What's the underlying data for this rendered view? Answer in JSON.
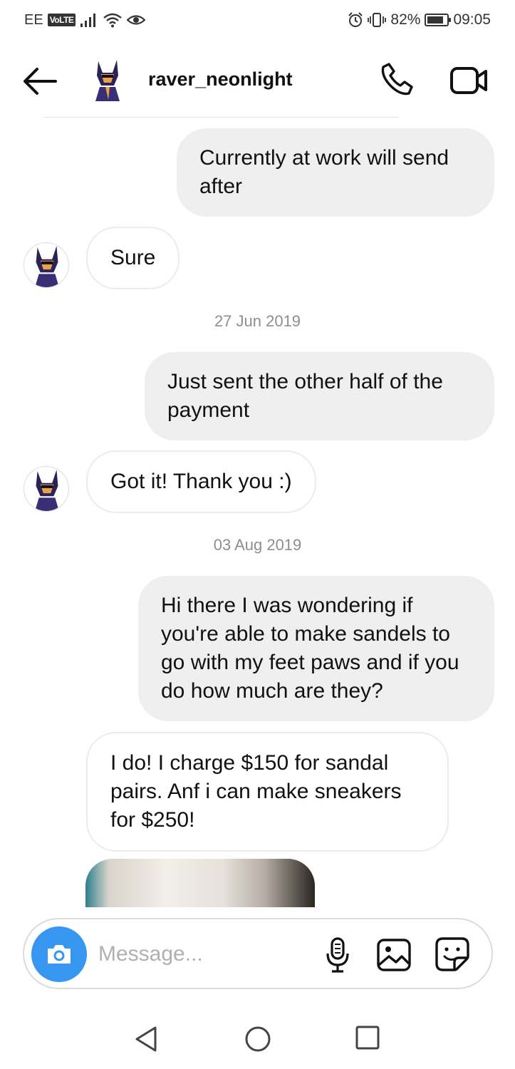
{
  "status_bar": {
    "carrier": "EE",
    "volte": "VoLTE",
    "battery_level": "82%",
    "battery_fraction": 0.82,
    "time": "09:05"
  },
  "header": {
    "username": "raver_neonlight"
  },
  "messages": [
    {
      "direction": "out",
      "text": "Currently at work will send after"
    },
    {
      "direction": "in",
      "text": "Sure"
    },
    {
      "direction": "date",
      "text": "27 Jun 2019"
    },
    {
      "direction": "out",
      "text": "Just sent the other half of the payment"
    },
    {
      "direction": "in",
      "text": "Got it! Thank you :)"
    },
    {
      "direction": "date",
      "text": "03 Aug 2019"
    },
    {
      "direction": "out",
      "text": "Hi there I was wondering if you're able to make sandels to go with my feet paws and if you do how much are they?"
    },
    {
      "direction": "in",
      "text": "I do! I charge $150 for sandal pairs. Anf i can make sneakers for $250!"
    }
  ],
  "composer": {
    "placeholder": "Message..."
  },
  "icons": {
    "back": "arrow-left-icon",
    "call": "phone-icon",
    "video": "video-camera-icon",
    "camera": "camera-icon",
    "mic": "microphone-icon",
    "gallery": "image-icon",
    "sticker": "sticker-icon"
  },
  "colors": {
    "accent": "#3797f0",
    "outgoing_bubble": "#efefef",
    "date_text": "#8e8e8e"
  }
}
